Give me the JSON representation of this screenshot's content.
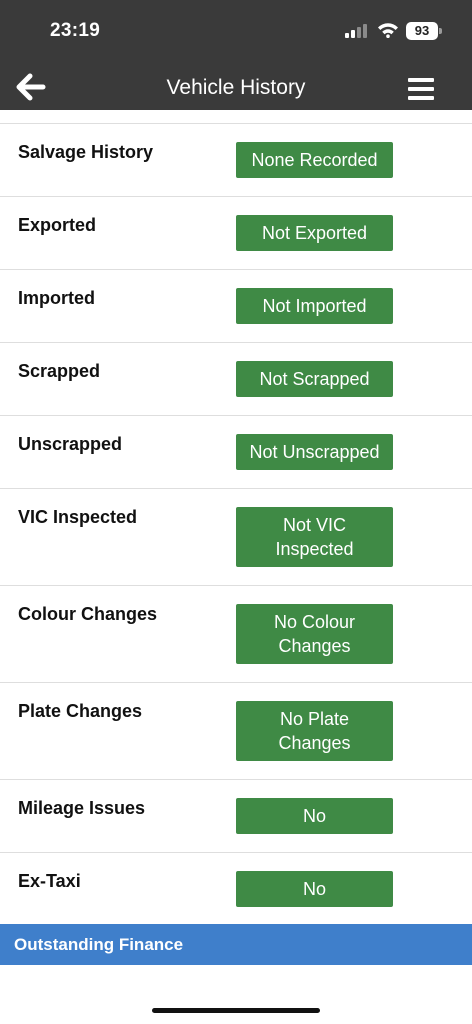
{
  "status_bar": {
    "time": "23:19",
    "battery": "93"
  },
  "header": {
    "title": "Vehicle History",
    "back_icon": "arrow-left-icon",
    "menu_icon": "hamburger-menu-icon"
  },
  "rows": [
    {
      "label": "Salvage History",
      "value": "None Recorded"
    },
    {
      "label": "Exported",
      "value": "Not Exported"
    },
    {
      "label": "Imported",
      "value": "Not Imported"
    },
    {
      "label": "Scrapped",
      "value": "Not Scrapped"
    },
    {
      "label": "Unscrapped",
      "value": "Not Unscrapped"
    },
    {
      "label": "VIC Inspected",
      "value": "Not VIC Inspected"
    },
    {
      "label": "Colour Changes",
      "value": "No Colour Changes"
    },
    {
      "label": "Plate Changes",
      "value": "No Plate Changes"
    },
    {
      "label": "Mileage Issues",
      "value": "No"
    },
    {
      "label": "Ex-Taxi",
      "value": "No"
    }
  ],
  "section": {
    "title": "Outstanding Finance"
  },
  "colors": {
    "header_bg": "#3a3a3a",
    "pill_green": "#3f8a45",
    "section_blue": "#3f7fcb"
  }
}
